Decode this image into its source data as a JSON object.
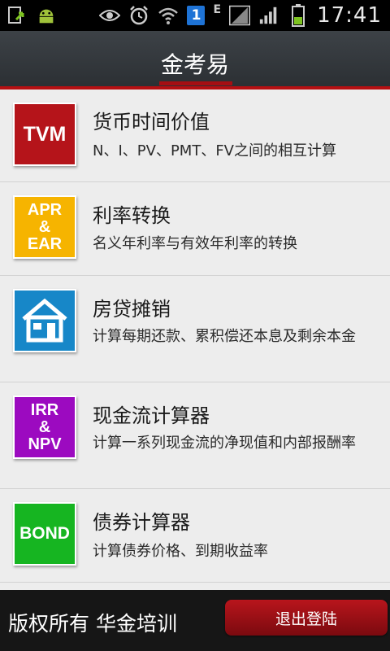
{
  "status_bar": {
    "time": "17:41",
    "notification_badge": "1",
    "network_type": "E",
    "icons": [
      "clipboard-arrow-icon",
      "android-icon",
      "eye-icon",
      "alarm-icon",
      "wifi-icon",
      "no-signal-icon",
      "signal-icon",
      "battery-icon"
    ],
    "battery_color": "#7ec321"
  },
  "header": {
    "title": "金考易",
    "accent_color": "#b50f12"
  },
  "items": [
    {
      "icon_text": "TVM",
      "icon_color": "#b5141a",
      "title": "货币时间价值",
      "desc": "N、I、PV、PMT、FV之间的相互计算"
    },
    {
      "icon_text": "APR & EAR",
      "icon_lines": [
        "APR",
        "&",
        "EAR"
      ],
      "icon_color": "#f6b400",
      "title": "利率转换",
      "desc": "名义年利率与有效年利率的转换"
    },
    {
      "icon_text": "house",
      "icon_color": "#1787c8",
      "title": "房贷摊销",
      "desc": "计算每期还款、累积偿还本息及剩余本金"
    },
    {
      "icon_text": "IRR & NPV",
      "icon_lines": [
        "IRR",
        "&",
        "NPV"
      ],
      "icon_color": "#9c0ac0",
      "title": "现金流计算器",
      "desc": "计算一系列现金流的净现值和内部报酬率"
    },
    {
      "icon_text": "BOND",
      "icon_color": "#16b521",
      "title": "债券计算器",
      "desc": "计算债券价格、到期收益率"
    }
  ],
  "footer": {
    "copyright": "版权所有 华金培训",
    "logout_label": "退出登陆"
  }
}
